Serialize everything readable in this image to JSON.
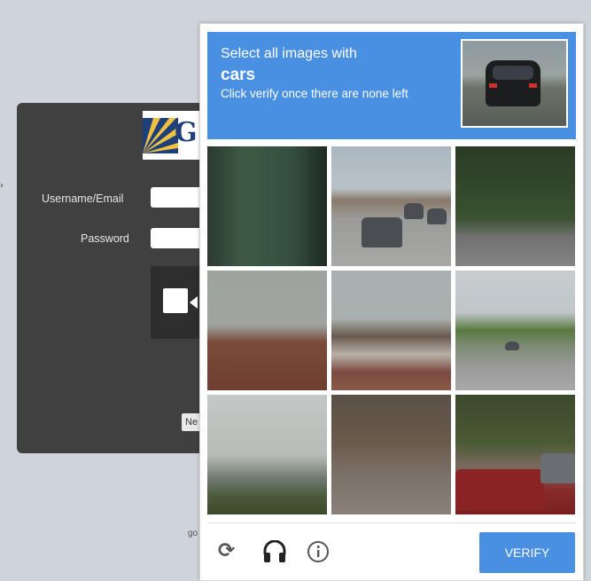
{
  "login": {
    "logo_letter": "G",
    "username_label": "Username/Email",
    "password_label": "Password",
    "ne_button_label": "Ne",
    "footer_text": "go"
  },
  "captcha": {
    "header": {
      "line1": "Select all images with",
      "target": "cars",
      "line3": "Click verify once there are none left"
    },
    "tiles": [
      {
        "id": 1
      },
      {
        "id": 2
      },
      {
        "id": 3
      },
      {
        "id": 4
      },
      {
        "id": 5
      },
      {
        "id": 6
      },
      {
        "id": 7
      },
      {
        "id": 8
      },
      {
        "id": 9
      }
    ],
    "footer": {
      "reload_icon": "reload-icon",
      "audio_icon": "headphones-icon",
      "info_icon": "info-icon",
      "verify_label": "VERIFY"
    },
    "colors": {
      "accent": "#4a90e2",
      "header_text": "#ffffff",
      "footer_icons": "#555555"
    }
  }
}
